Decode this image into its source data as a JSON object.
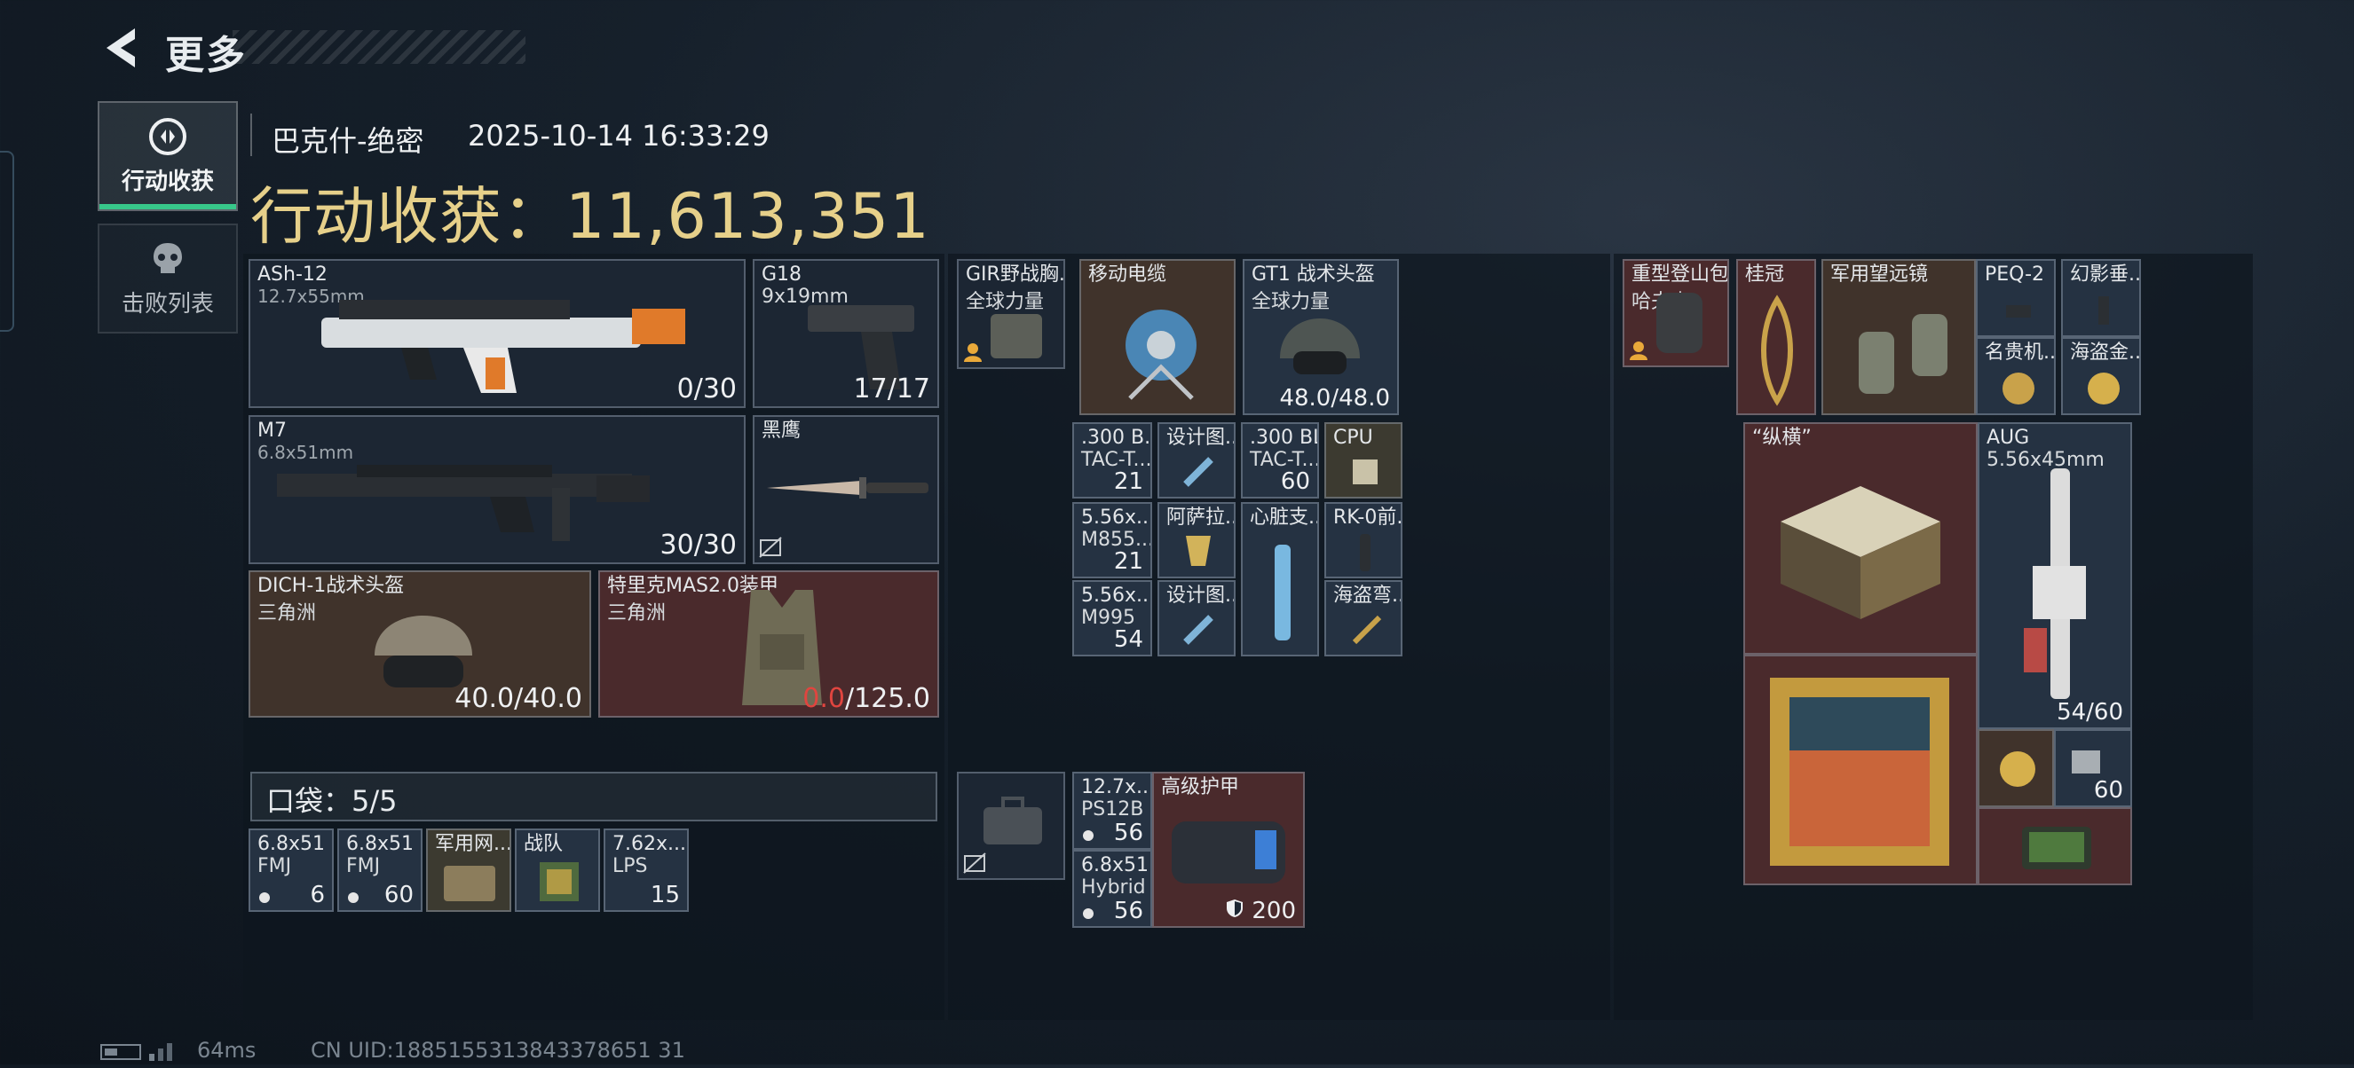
{
  "topbar": {
    "title": "更多"
  },
  "tabs": [
    {
      "label": "行动收获",
      "active": true,
      "icon": "loot-icon"
    },
    {
      "label": "击败列表",
      "active": false,
      "icon": "skull-icon"
    }
  ],
  "header": {
    "map": "巴克什-绝密",
    "datetime": "2025-10-14 16:33:29",
    "haul_label": "行动收获：",
    "haul_value": "11,613,351"
  },
  "equipment": {
    "primary": {
      "name": "ASh-12",
      "caliber": "12.7x55mm",
      "ammo": "0/30"
    },
    "pistol": {
      "name": "G18",
      "caliber": "9x19mm",
      "ammo": "17/17"
    },
    "secondary": {
      "name": "M7",
      "caliber": "6.8x51mm",
      "ammo": "30/30"
    },
    "melee": {
      "name": "黑鹰"
    },
    "helmet": {
      "name": "DICH-1战术头盔",
      "faction": "三角洲",
      "durability": "40.0/40.0"
    },
    "armor": {
      "name": "特里克MAS2.0装甲",
      "faction": "三角洲",
      "durability_cur": "0.0",
      "durability_max": "/125.0"
    }
  },
  "pocket": {
    "label": "口袋：",
    "count": "5/5",
    "items": [
      {
        "name": "6.8x51",
        "sub": "FMJ",
        "count": "6"
      },
      {
        "name": "6.8x51",
        "sub": "FMJ",
        "count": "60"
      },
      {
        "name": "军用网...",
        "sub": "",
        "count": ""
      },
      {
        "name": "战队",
        "sub": "",
        "count": ""
      },
      {
        "name": "7.62x...",
        "sub": "LPS",
        "count": "15"
      }
    ]
  },
  "chest_rig": {
    "name": "GIR野战胸...",
    "sub": "全球力量",
    "items": [
      {
        "name": "移动电缆",
        "count": ""
      },
      {
        "name": "GT1 战术头盔",
        "sub": "全球力量",
        "count": "48.0/48.0"
      },
      {
        "name": ".300 B...",
        "sub": "TAC-T...",
        "count": "21"
      },
      {
        "name": "设计图...",
        "count": ""
      },
      {
        "name": ".300 BL...",
        "sub": "TAC-T...",
        "count": "60"
      },
      {
        "name": "CPU",
        "count": ""
      },
      {
        "name": "5.56x...",
        "sub": "M855...",
        "count": "21"
      },
      {
        "name": "阿萨拉...",
        "count": ""
      },
      {
        "name": "心脏支...",
        "count": ""
      },
      {
        "name": "RK-0前...",
        "count": ""
      },
      {
        "name": "5.56x...",
        "sub": "M995",
        "count": "54"
      },
      {
        "name": "设计图...",
        "count": ""
      },
      {
        "name": "海盗弯...",
        "count": ""
      }
    ]
  },
  "case": {
    "items": [
      {
        "name": "12.7x...",
        "sub": "PS12B",
        "count": "56"
      },
      {
        "name": "6.8x51",
        "sub": "Hybrid",
        "count": "56"
      },
      {
        "name": "高级护甲",
        "count": "200"
      }
    ]
  },
  "backpack": {
    "name": "重型登山包",
    "sub": "哈夫克",
    "items": [
      {
        "name": "桂冠"
      },
      {
        "name": "军用望远镜"
      },
      {
        "name": "PEQ-2"
      },
      {
        "name": "幻影垂..."
      },
      {
        "name": "名贵机..."
      },
      {
        "name": "海盗金..."
      },
      {
        "name": "“纵横”"
      },
      {
        "name": "AUG",
        "sub": "5.56x45mm",
        "count": "54/60"
      },
      {
        "name": "",
        "count": "60"
      }
    ]
  },
  "status": {
    "ping": "64ms",
    "uid": "CN UID:1885155313843378651 31"
  }
}
